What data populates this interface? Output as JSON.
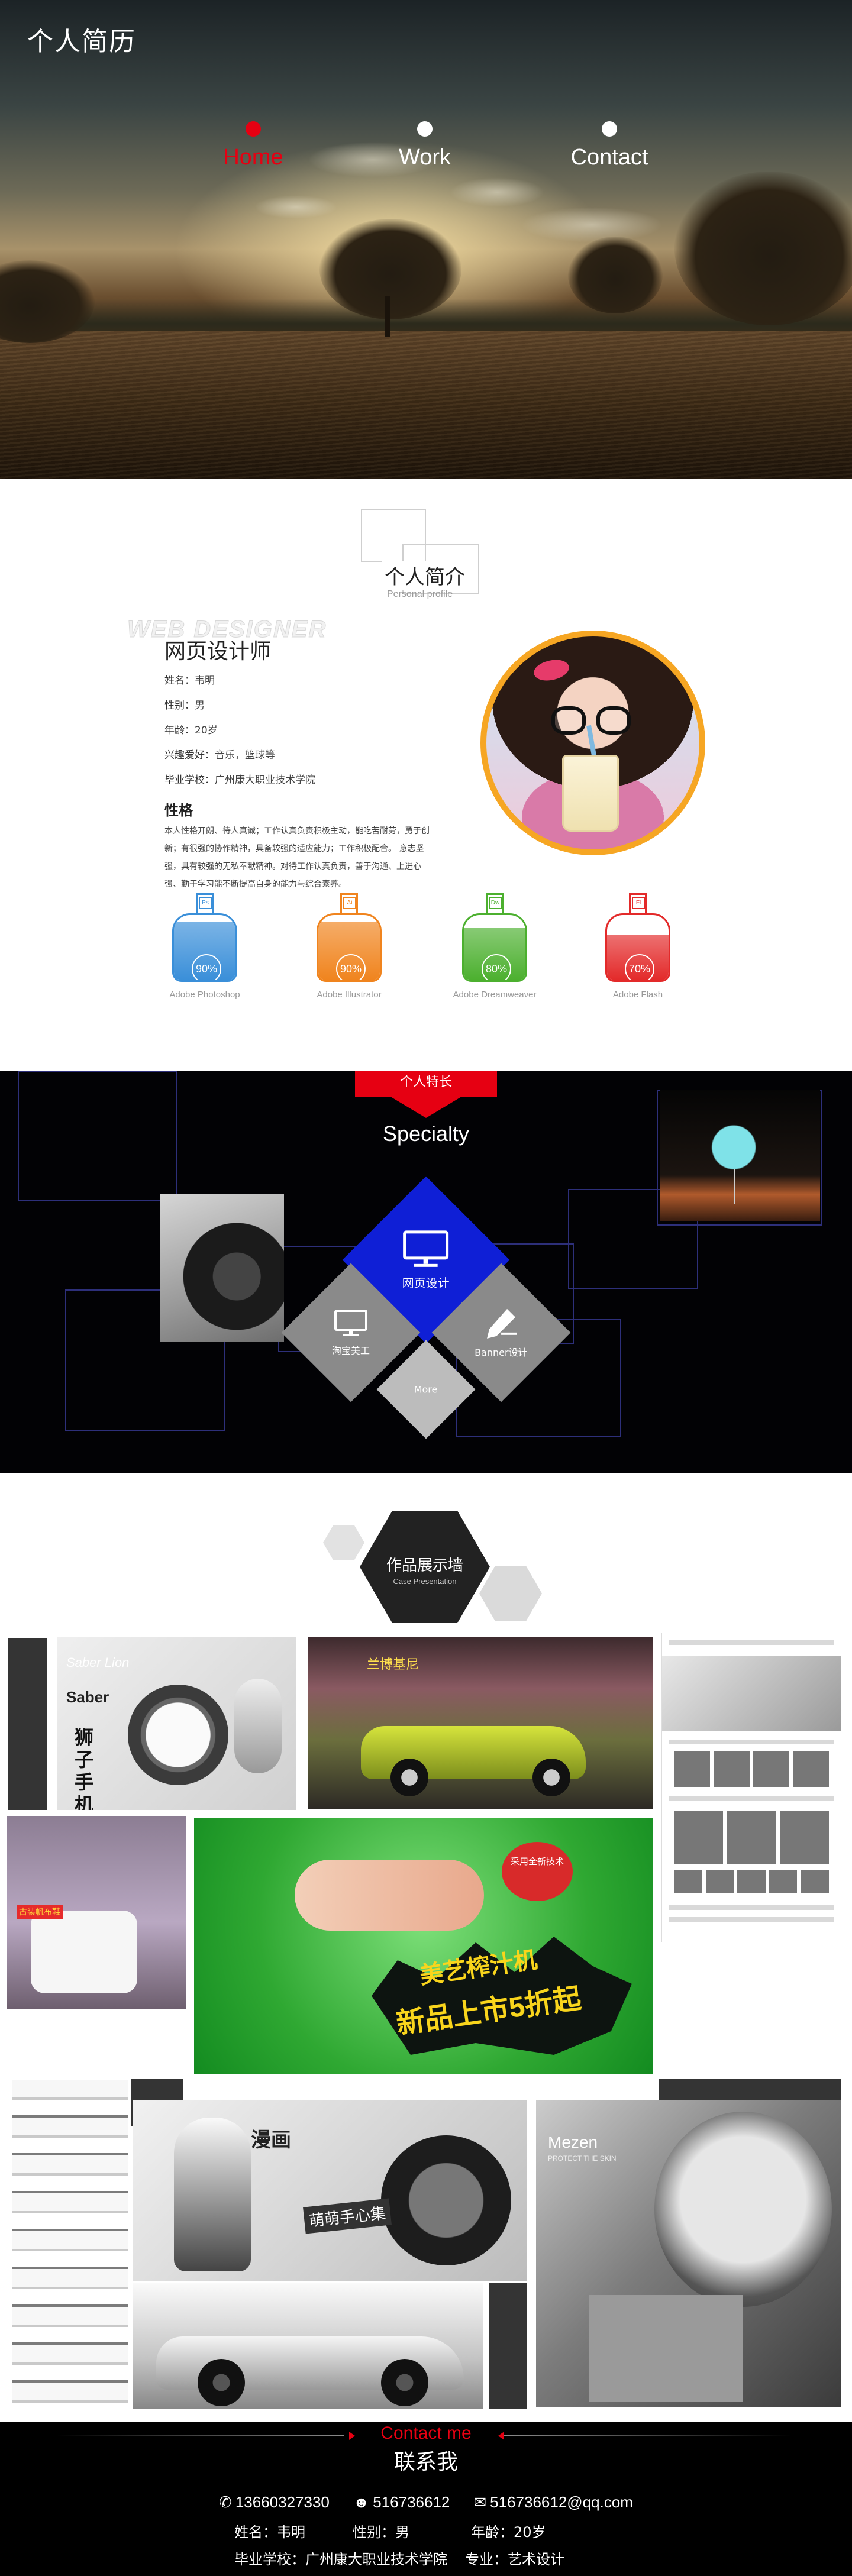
{
  "hero": {
    "site_title": "个人简历",
    "nav": [
      {
        "label": "Home",
        "active": true
      },
      {
        "label": "Work",
        "active": false
      },
      {
        "label": "Contact",
        "active": false
      }
    ]
  },
  "profile": {
    "section_title": "个人简介",
    "section_subtitle": "Personal profile",
    "watermark": "WEB DESIGNER",
    "role": "网页设计师",
    "info": [
      {
        "key": "姓名：",
        "value": "韦明"
      },
      {
        "key": "性别：",
        "value": "男"
      },
      {
        "key": "年龄：",
        "value": "20岁"
      },
      {
        "key": "兴趣爱好：",
        "value": "音乐，篮球等"
      },
      {
        "key": "毕业学校：",
        "value": "广州康大职业技术学院"
      }
    ],
    "character_title": "性格",
    "character_text": "本人性格开朗、待人真诚；工作认真负责积极主动，能吃苦耐劳，勇于创新；有很强的协作精神，具备较强的适应能力；工作积极配合。 意志坚强，具有较强的无私奉献精神。对待工作认真负责，善于沟通、上进心强、勤于学习能不断提高自身的能力与综合素养。",
    "skills": [
      {
        "icon": "Ps",
        "percent": "90%",
        "value": 0.9,
        "name": "Adobe Photoshop",
        "color": "#3a8fd9"
      },
      {
        "icon": "Ai",
        "percent": "90%",
        "value": 0.9,
        "name": "Adobe Illustrator",
        "color": "#f0841e"
      },
      {
        "icon": "Dw",
        "percent": "80%",
        "value": 0.8,
        "name": "Adobe Dreamweaver",
        "color": "#4cb02f"
      },
      {
        "icon": "Fl",
        "percent": "70%",
        "value": 0.7,
        "name": "Adobe  Flash",
        "color": "#e32a2a"
      }
    ]
  },
  "specialty": {
    "tab": "个人特长",
    "title": "Specialty",
    "main": "网页设计",
    "left": "淘宝美工",
    "right": "Banner设计",
    "bottom": "More"
  },
  "works": {
    "title": "作品展示墙",
    "subtitle": "Case Presentation",
    "saber_caption_en": "Saber Lion",
    "saber_caption": "Saber",
    "saber_side": "狮子手机壳",
    "car_caption": "兰博基尼",
    "anime_caption": "古装帆布鞋",
    "juicer_badge": "采用全新技术",
    "juicer_line1": "美艺榨汁机",
    "juicer_line2": "新品上市5折起",
    "manga_caption": "漫画",
    "manga_tag": "萌萌手心集",
    "mezen_caption": "Mezen",
    "mezen_sub": "PROTECT THE SKIN"
  },
  "contact": {
    "title_en": "Contact me",
    "title_zh": "联系我",
    "phone": "13660327330",
    "qq": "516736612",
    "email": "516736612@qq.com",
    "name": "姓名：韦明",
    "gender": "性别：男",
    "age": "年龄：20岁",
    "school": "毕业学校：广州康大职业技术学院",
    "major": "专业：艺术设计"
  },
  "colors": {
    "accent": "#e60012",
    "specialty_blue": "#0f1fd6",
    "avatar_ring": "#f6a623"
  }
}
